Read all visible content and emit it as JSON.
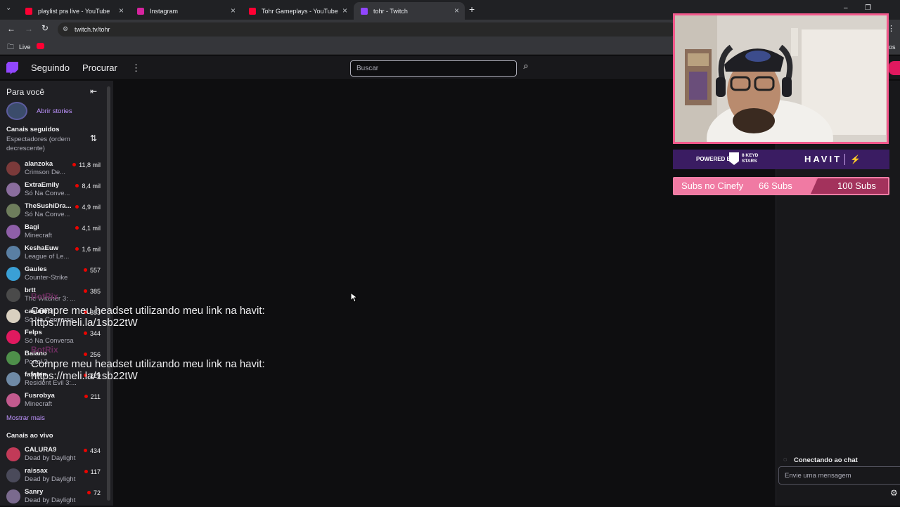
{
  "browser": {
    "tabs": [
      {
        "title": "playlist pra live - YouTube",
        "favicon_color": "#ff0033"
      },
      {
        "title": "Instagram",
        "favicon_color": "#d6249f"
      },
      {
        "title": "Tohr Gameplays - YouTube",
        "favicon_color": "#ff0033"
      },
      {
        "title": "tohr - Twitch",
        "favicon_color": "#9146ff",
        "active": true
      }
    ],
    "new_tab": "+",
    "url": "twitch.tv/tohr",
    "bookmarks": [
      {
        "label": "Live"
      }
    ],
    "partial_right_text": "os"
  },
  "twitch_nav": {
    "following": "Seguindo",
    "browse": "Procurar",
    "search_placeholder": "Buscar"
  },
  "sidebar": {
    "for_you": "Para você",
    "stories": "Abrir stories",
    "followed_title": "Canais seguidos",
    "sort_label": "Espectadores (ordem decrescente)",
    "followed": [
      {
        "name": "alanzoka",
        "game": "Crimson De...",
        "viewers": "11,8 mil",
        "color": "#7b3a3a"
      },
      {
        "name": "ExtraEmily",
        "game": "Só Na Conve...",
        "viewers": "8,4 mil",
        "color": "#8a6d9e"
      },
      {
        "name": "TheSushiDra...",
        "game": "Só Na Conve...",
        "viewers": "4,9 mil",
        "color": "#6e7d5c"
      },
      {
        "name": "Bagi",
        "game": "Minecraft",
        "viewers": "4,1 mil",
        "color": "#8e5fa8"
      },
      {
        "name": "KeshaEuw",
        "game": "League of Le...",
        "viewers": "1,6 mil",
        "color": "#5a7fa3"
      },
      {
        "name": "Gaules",
        "game": "Counter-Strike",
        "viewers": "557",
        "color": "#3aa0d6"
      },
      {
        "name": "brtt",
        "game": "The Witcher 3: ...",
        "viewers": "385",
        "color": "#4a4a4a"
      },
      {
        "name": "casimiro",
        "game": "Só Na Conversa",
        "viewers": "383",
        "color": "#d9d0c0"
      },
      {
        "name": "Felps",
        "game": "Só Na Conversa",
        "viewers": "344",
        "color": "#e0195f"
      },
      {
        "name": "Baiano",
        "game": "Portal 2",
        "viewers": "256",
        "color": "#4e8f4a"
      },
      {
        "name": "fafaten",
        "game": "Resident Evil 3:...",
        "viewers": "229",
        "color": "#6f8aa6"
      },
      {
        "name": "Fusrobya",
        "game": "Minecraft",
        "viewers": "211",
        "color": "#c25a8e"
      }
    ],
    "show_more": "Mostrar mais",
    "live_title": "Canais ao vivo",
    "live": [
      {
        "name": "CALURA9",
        "game": "Dead by Daylight",
        "viewers": "434",
        "color": "#c23a58"
      },
      {
        "name": "raissax",
        "game": "Dead by Daylight",
        "viewers": "117",
        "color": "#4a4a5a"
      },
      {
        "name": "Sanry",
        "game": "Dead by Daylight",
        "viewers": "72",
        "color": "#7a6a8e"
      }
    ]
  },
  "overlay": {
    "powered_by": "POWERED BY",
    "sponsor_team": "8 KEYD STARS",
    "sponsor_brand": "HAVIT",
    "subs_label": "Subs no Cinefy",
    "subs_current": "66 Subs",
    "subs_goal": "100 Subs",
    "subs_progress": 0.66
  },
  "bot_messages": [
    {
      "name": "BotRix",
      "text": "Compre meu headset utilizando meu link na havit: https://meli.la/1sb22tW"
    },
    {
      "name": "BotRix",
      "text": "Compre meu headset utilizando meu link na havit: https://meli.la/1sb22tW"
    }
  ],
  "chat": {
    "connecting": "Conectando ao chat",
    "input_placeholder": "Envie uma mensagem"
  }
}
